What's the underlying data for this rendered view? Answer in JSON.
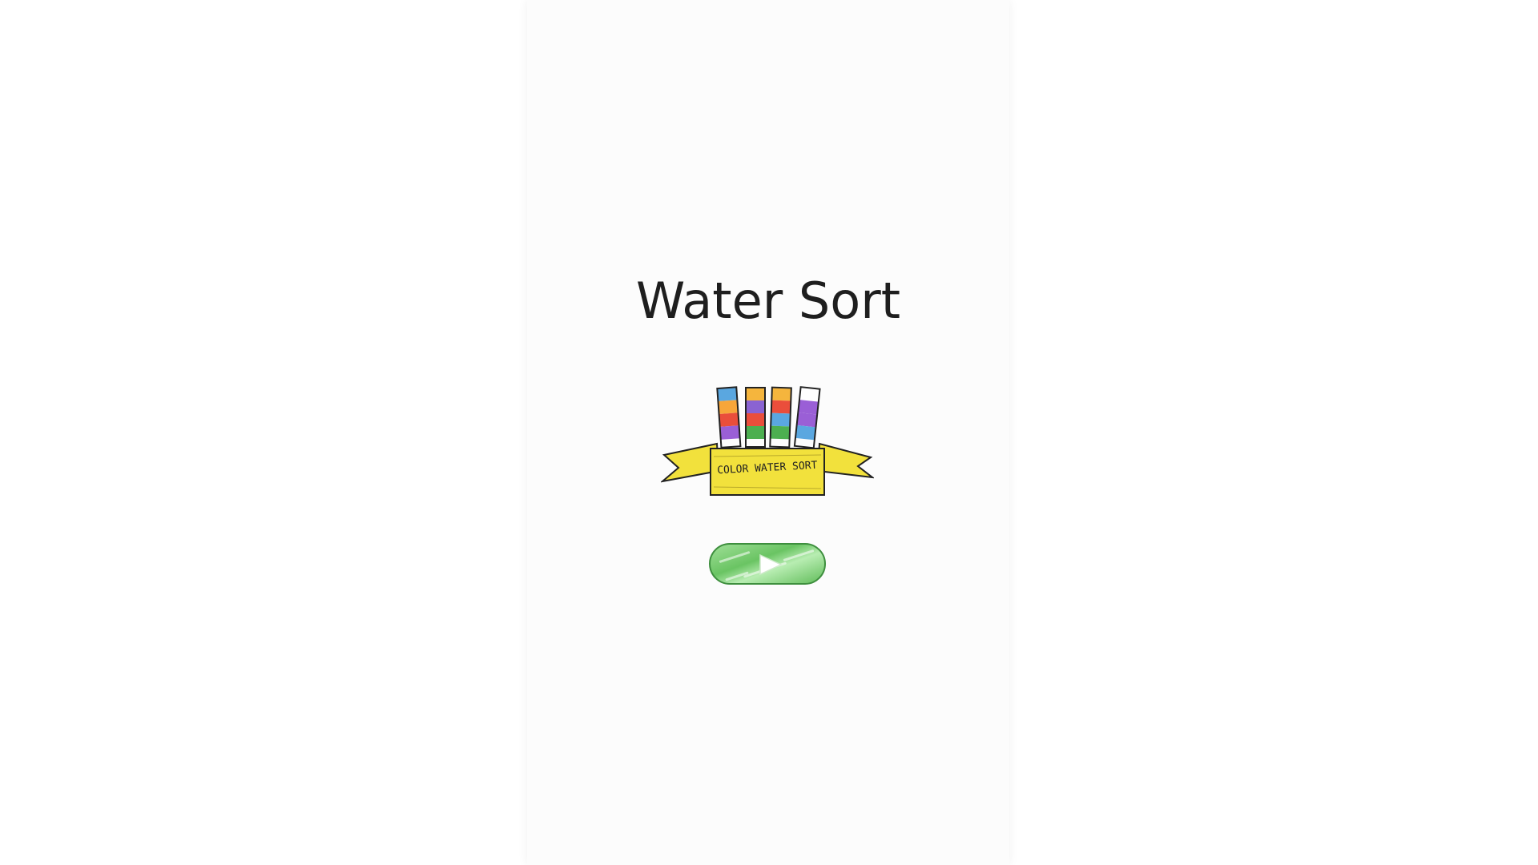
{
  "game": {
    "title": "Water Sort"
  },
  "logo": {
    "ribbon_text": "COLOR WATER SORT",
    "ribbon_color": "#f2e13c",
    "tubes": [
      [
        "#5aa7e0",
        "#f7a63a",
        "#ea4e3b",
        "#9a5fd6"
      ],
      [
        "#f5b53d",
        "#8a63d2",
        "#ea4e3b",
        "#4caf50"
      ],
      [
        "#f5b53d",
        "#ea4e3b",
        "#5aa7e0",
        "#4caf50"
      ],
      [
        "#ffffff",
        "#9a5fd6",
        "#9a5fd6",
        "#5aa7e0"
      ]
    ]
  },
  "play_button": {
    "icon": "play-icon",
    "color": "#6ac463"
  }
}
